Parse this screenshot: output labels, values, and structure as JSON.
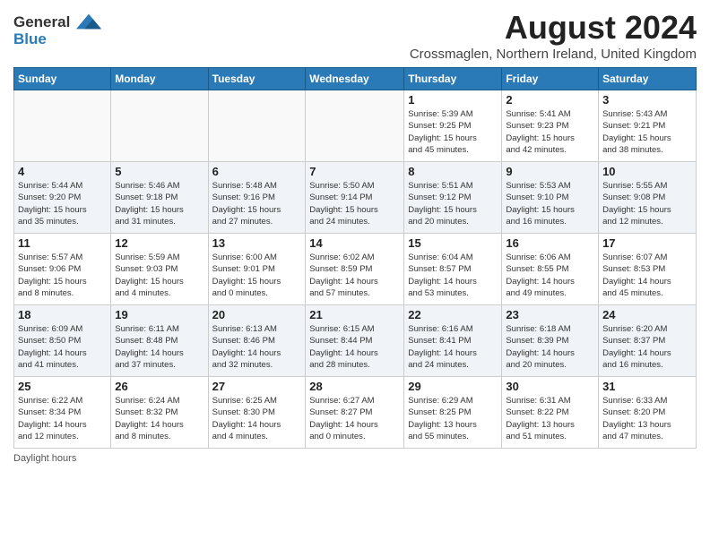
{
  "logo": {
    "line1": "General",
    "line2": "Blue"
  },
  "title": "August 2024",
  "subtitle": "Crossmaglen, Northern Ireland, United Kingdom",
  "columns": [
    "Sunday",
    "Monday",
    "Tuesday",
    "Wednesday",
    "Thursday",
    "Friday",
    "Saturday"
  ],
  "footer": "Daylight hours",
  "weeks": [
    [
      {
        "day": "",
        "info": ""
      },
      {
        "day": "",
        "info": ""
      },
      {
        "day": "",
        "info": ""
      },
      {
        "day": "",
        "info": ""
      },
      {
        "day": "1",
        "info": "Sunrise: 5:39 AM\nSunset: 9:25 PM\nDaylight: 15 hours\nand 45 minutes."
      },
      {
        "day": "2",
        "info": "Sunrise: 5:41 AM\nSunset: 9:23 PM\nDaylight: 15 hours\nand 42 minutes."
      },
      {
        "day": "3",
        "info": "Sunrise: 5:43 AM\nSunset: 9:21 PM\nDaylight: 15 hours\nand 38 minutes."
      }
    ],
    [
      {
        "day": "4",
        "info": "Sunrise: 5:44 AM\nSunset: 9:20 PM\nDaylight: 15 hours\nand 35 minutes."
      },
      {
        "day": "5",
        "info": "Sunrise: 5:46 AM\nSunset: 9:18 PM\nDaylight: 15 hours\nand 31 minutes."
      },
      {
        "day": "6",
        "info": "Sunrise: 5:48 AM\nSunset: 9:16 PM\nDaylight: 15 hours\nand 27 minutes."
      },
      {
        "day": "7",
        "info": "Sunrise: 5:50 AM\nSunset: 9:14 PM\nDaylight: 15 hours\nand 24 minutes."
      },
      {
        "day": "8",
        "info": "Sunrise: 5:51 AM\nSunset: 9:12 PM\nDaylight: 15 hours\nand 20 minutes."
      },
      {
        "day": "9",
        "info": "Sunrise: 5:53 AM\nSunset: 9:10 PM\nDaylight: 15 hours\nand 16 minutes."
      },
      {
        "day": "10",
        "info": "Sunrise: 5:55 AM\nSunset: 9:08 PM\nDaylight: 15 hours\nand 12 minutes."
      }
    ],
    [
      {
        "day": "11",
        "info": "Sunrise: 5:57 AM\nSunset: 9:06 PM\nDaylight: 15 hours\nand 8 minutes."
      },
      {
        "day": "12",
        "info": "Sunrise: 5:59 AM\nSunset: 9:03 PM\nDaylight: 15 hours\nand 4 minutes."
      },
      {
        "day": "13",
        "info": "Sunrise: 6:00 AM\nSunset: 9:01 PM\nDaylight: 15 hours\nand 0 minutes."
      },
      {
        "day": "14",
        "info": "Sunrise: 6:02 AM\nSunset: 8:59 PM\nDaylight: 14 hours\nand 57 minutes."
      },
      {
        "day": "15",
        "info": "Sunrise: 6:04 AM\nSunset: 8:57 PM\nDaylight: 14 hours\nand 53 minutes."
      },
      {
        "day": "16",
        "info": "Sunrise: 6:06 AM\nSunset: 8:55 PM\nDaylight: 14 hours\nand 49 minutes."
      },
      {
        "day": "17",
        "info": "Sunrise: 6:07 AM\nSunset: 8:53 PM\nDaylight: 14 hours\nand 45 minutes."
      }
    ],
    [
      {
        "day": "18",
        "info": "Sunrise: 6:09 AM\nSunset: 8:50 PM\nDaylight: 14 hours\nand 41 minutes."
      },
      {
        "day": "19",
        "info": "Sunrise: 6:11 AM\nSunset: 8:48 PM\nDaylight: 14 hours\nand 37 minutes."
      },
      {
        "day": "20",
        "info": "Sunrise: 6:13 AM\nSunset: 8:46 PM\nDaylight: 14 hours\nand 32 minutes."
      },
      {
        "day": "21",
        "info": "Sunrise: 6:15 AM\nSunset: 8:44 PM\nDaylight: 14 hours\nand 28 minutes."
      },
      {
        "day": "22",
        "info": "Sunrise: 6:16 AM\nSunset: 8:41 PM\nDaylight: 14 hours\nand 24 minutes."
      },
      {
        "day": "23",
        "info": "Sunrise: 6:18 AM\nSunset: 8:39 PM\nDaylight: 14 hours\nand 20 minutes."
      },
      {
        "day": "24",
        "info": "Sunrise: 6:20 AM\nSunset: 8:37 PM\nDaylight: 14 hours\nand 16 minutes."
      }
    ],
    [
      {
        "day": "25",
        "info": "Sunrise: 6:22 AM\nSunset: 8:34 PM\nDaylight: 14 hours\nand 12 minutes."
      },
      {
        "day": "26",
        "info": "Sunrise: 6:24 AM\nSunset: 8:32 PM\nDaylight: 14 hours\nand 8 minutes."
      },
      {
        "day": "27",
        "info": "Sunrise: 6:25 AM\nSunset: 8:30 PM\nDaylight: 14 hours\nand 4 minutes."
      },
      {
        "day": "28",
        "info": "Sunrise: 6:27 AM\nSunset: 8:27 PM\nDaylight: 14 hours\nand 0 minutes."
      },
      {
        "day": "29",
        "info": "Sunrise: 6:29 AM\nSunset: 8:25 PM\nDaylight: 13 hours\nand 55 minutes."
      },
      {
        "day": "30",
        "info": "Sunrise: 6:31 AM\nSunset: 8:22 PM\nDaylight: 13 hours\nand 51 minutes."
      },
      {
        "day": "31",
        "info": "Sunrise: 6:33 AM\nSunset: 8:20 PM\nDaylight: 13 hours\nand 47 minutes."
      }
    ]
  ]
}
